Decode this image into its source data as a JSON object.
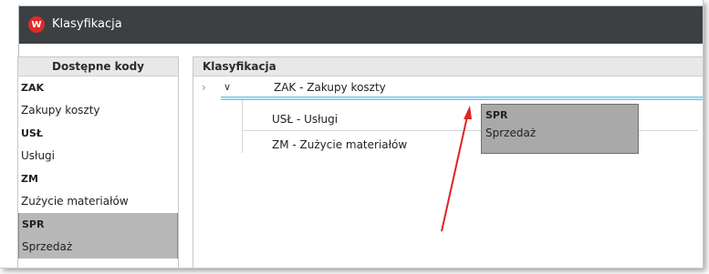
{
  "window": {
    "title": "Klasyfikacja",
    "logo_letter": "W",
    "accent_color": "#e02a2a",
    "titlebar_color": "#3c4043"
  },
  "left_panel": {
    "header": "Dostępne kody",
    "items": [
      {
        "code": "ZAK",
        "label": "Zakupy koszty",
        "selected": false
      },
      {
        "code": "USŁ",
        "label": "Usługi",
        "selected": false
      },
      {
        "code": "ZM",
        "label": "Zużycie materiałów",
        "selected": false
      },
      {
        "code": "SPR",
        "label": "Sprzedaż",
        "selected": true
      }
    ]
  },
  "right_panel": {
    "header": "Klasyfikacja",
    "tree": [
      {
        "label": "ZAK - Zakupy koszty",
        "expanded": true,
        "children": [
          {
            "label": "USŁ - Usługi"
          },
          {
            "label": "ZM - Zużycie materiałów"
          }
        ]
      }
    ]
  },
  "drag_ghost": {
    "code": "SPR",
    "label": "Sprzedaż"
  },
  "annotation": {
    "arrow_color": "#e02424"
  }
}
